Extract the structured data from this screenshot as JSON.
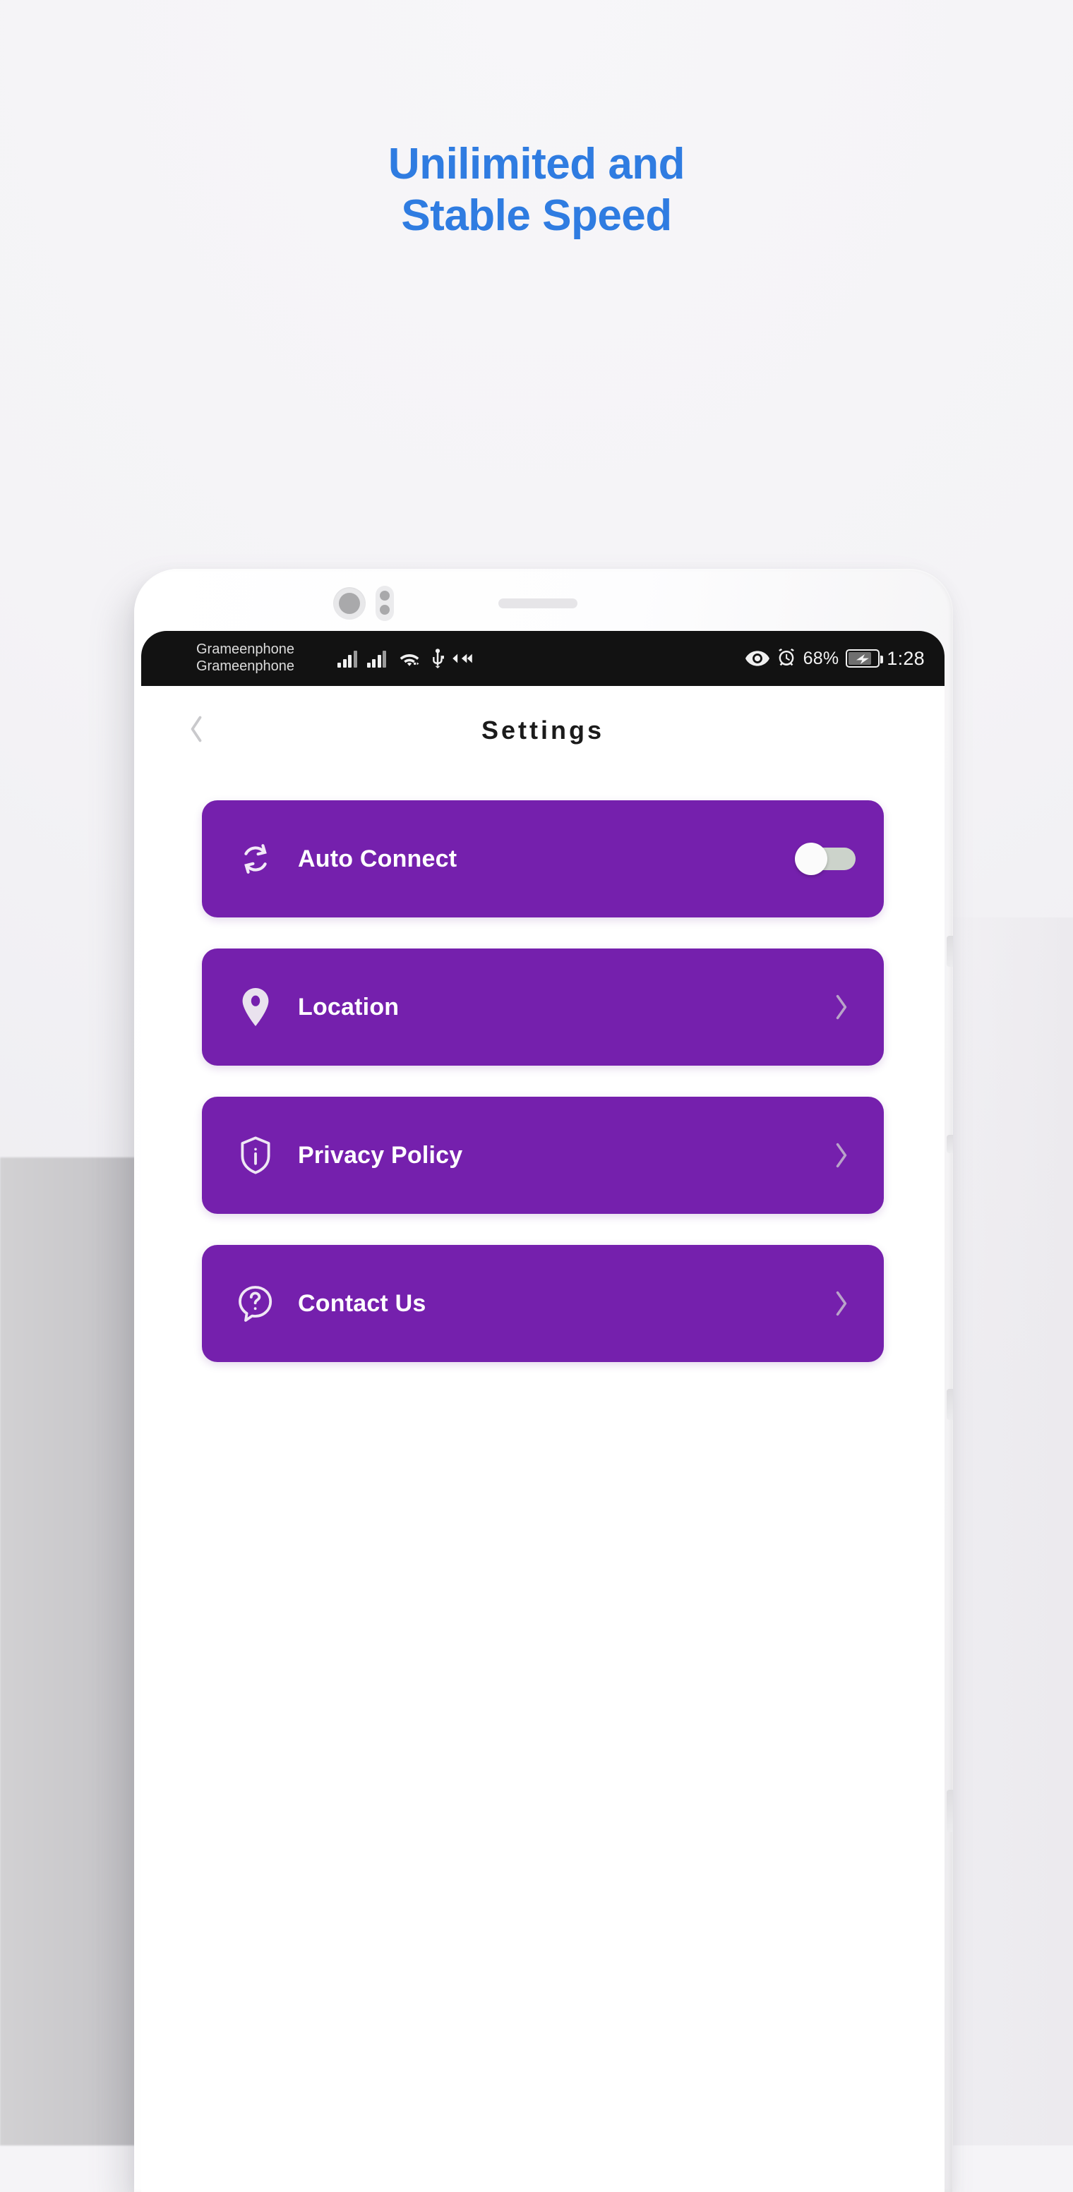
{
  "promo": {
    "headline_line1": "Unilimited and",
    "headline_line2": "Stable Speed",
    "headline_color": "#2f7ce1"
  },
  "statusbar": {
    "carrier_sim1": "Grameenphone",
    "carrier_sim2": "Grameenphone",
    "battery_percent": "68%",
    "clock": "1:28",
    "icons": [
      "signal-bars-sim1-icon",
      "signal-bars-sim2-icon",
      "wifi-icon",
      "usb-icon",
      "data-transfer-icon",
      "eye-icon",
      "alarm-icon",
      "battery-charging-icon"
    ],
    "background_color": "#121212"
  },
  "appbar": {
    "back_icon": "chevron-left-icon",
    "title": "Settings"
  },
  "settings": {
    "accent_color": "#7520ad",
    "items": [
      {
        "id": "auto-connect",
        "label": "Auto Connect",
        "icon": "sync-refresh-icon",
        "control": "toggle",
        "toggle_on": false
      },
      {
        "id": "location",
        "label": "Location",
        "icon": "map-pin-icon",
        "control": "chevron",
        "chevron_icon": "chevron-right-icon"
      },
      {
        "id": "privacy-policy",
        "label": "Privacy Policy",
        "icon": "shield-info-icon",
        "control": "chevron",
        "chevron_icon": "chevron-right-icon"
      },
      {
        "id": "contact-us",
        "label": "Contact Us",
        "icon": "question-bubble-icon",
        "control": "chevron",
        "chevron_icon": "chevron-right-icon"
      }
    ]
  },
  "device": {
    "frame_color": "#ffffff",
    "hardware": [
      "front-camera-lens",
      "proximity-sensor",
      "earpiece-speaker-grille",
      "side-button"
    ]
  }
}
